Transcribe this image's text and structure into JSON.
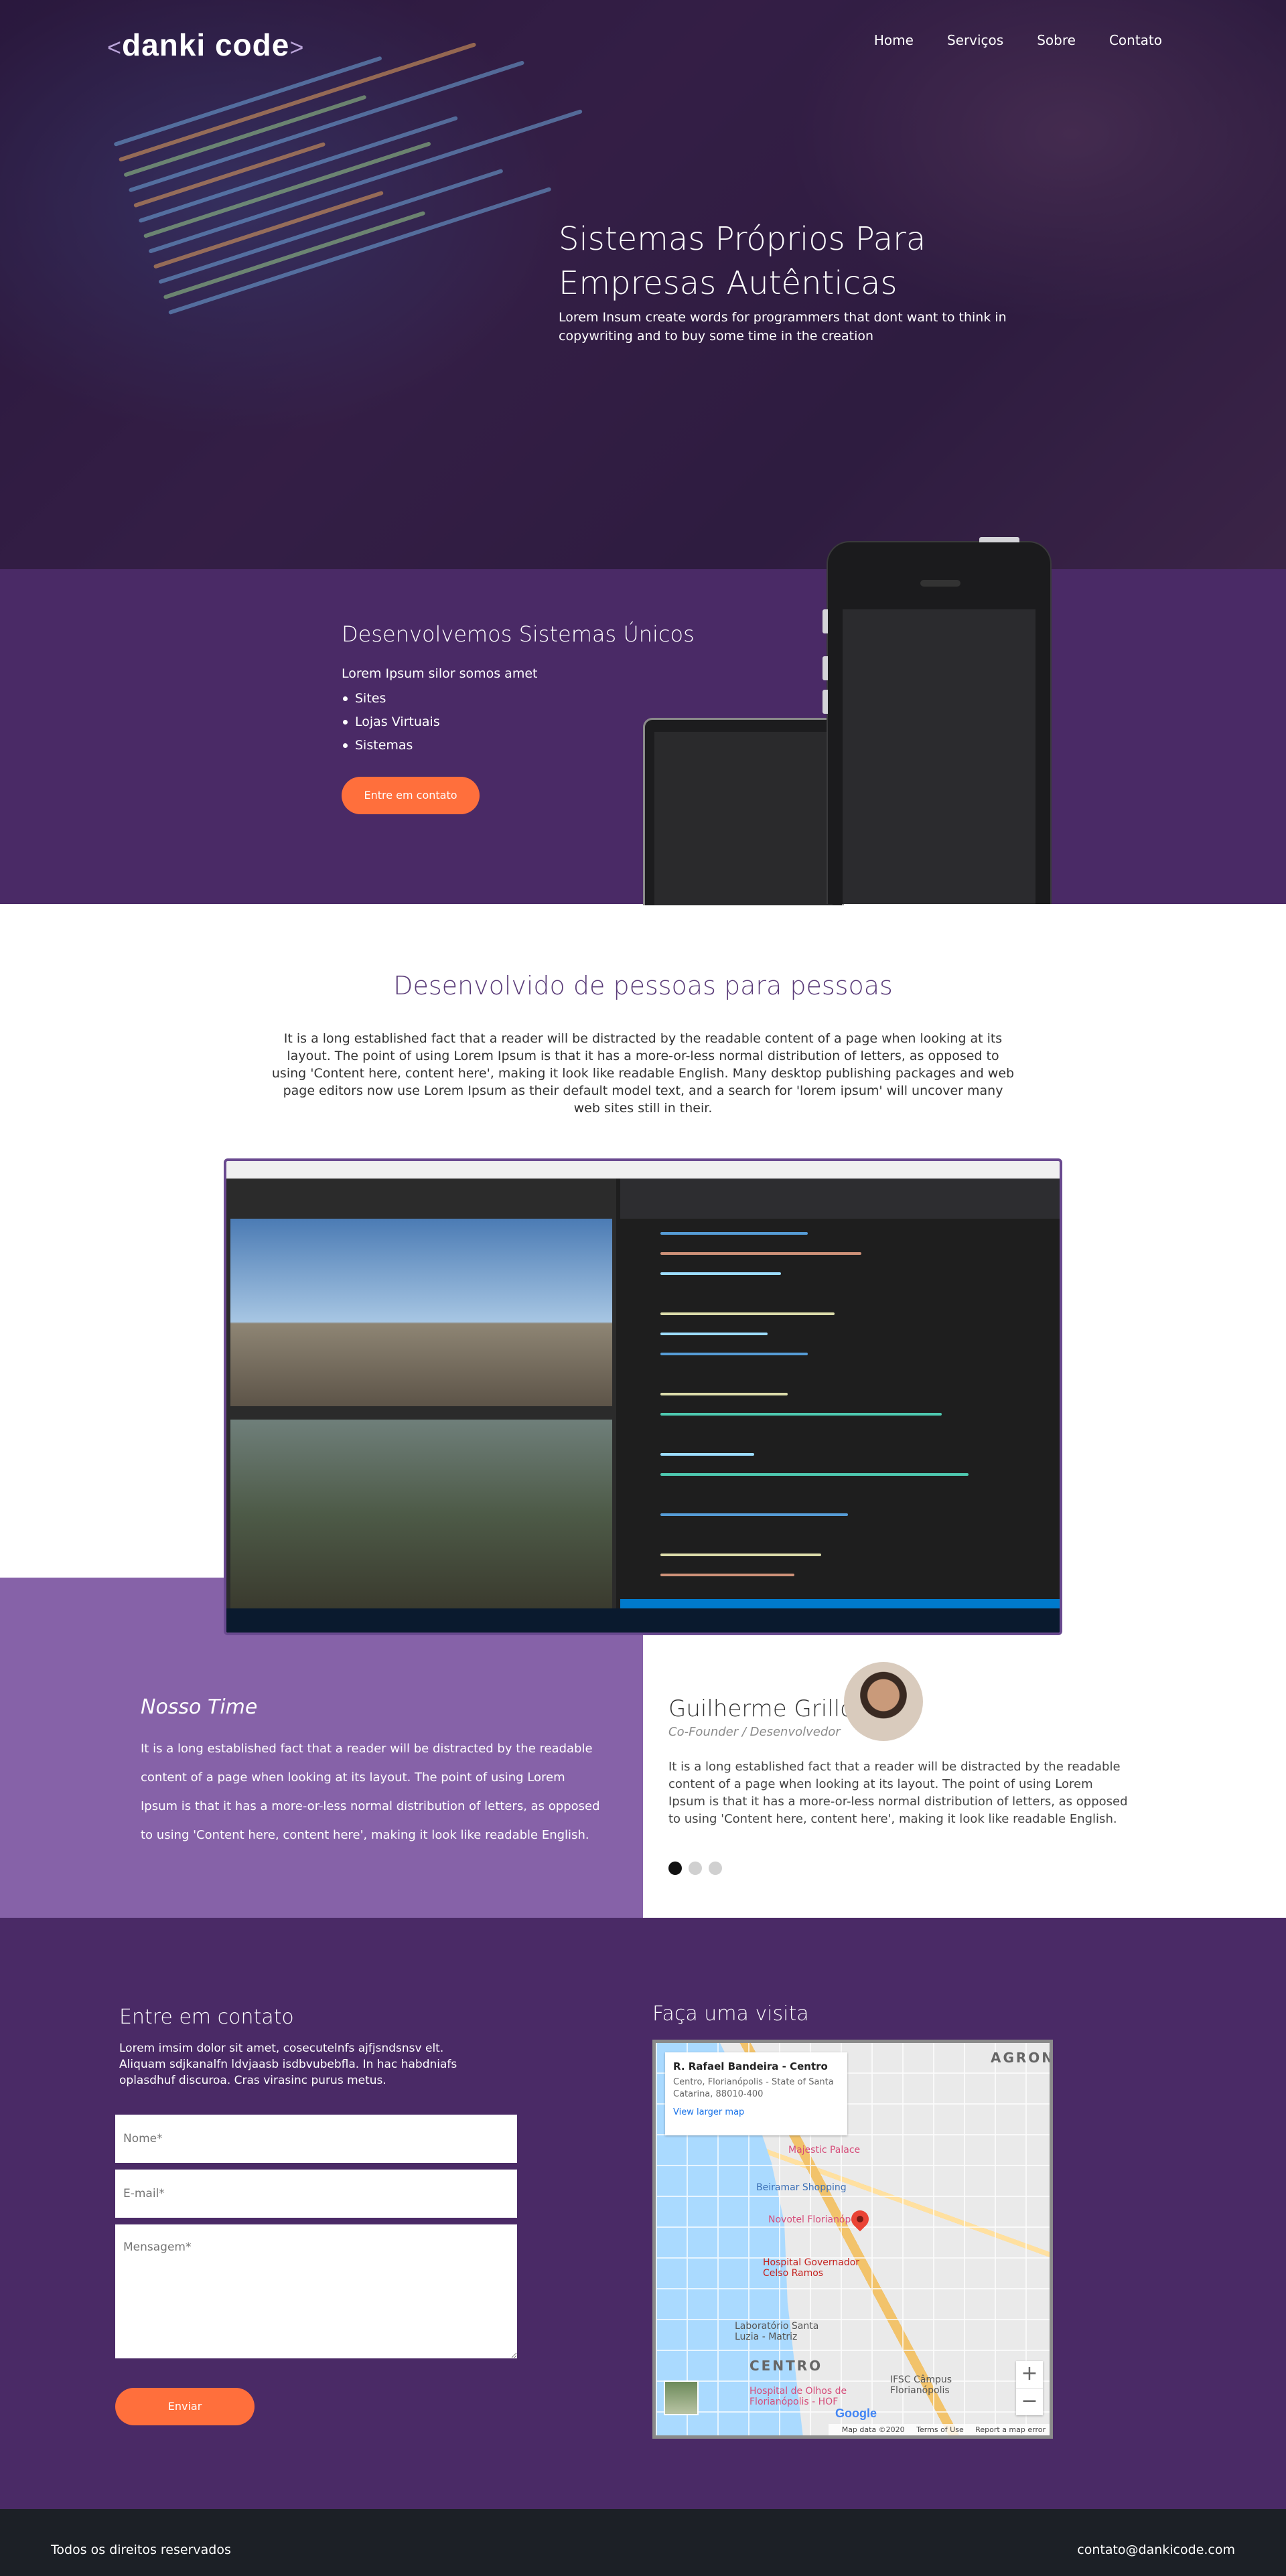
{
  "header": {
    "logo": "danki code",
    "nav": [
      "Home",
      "Serviços",
      "Sobre",
      "Contato"
    ]
  },
  "hero": {
    "title": "Sistemas Próprios Para Empresas Autênticas",
    "subtitle": "Lorem Insum create words for programmers that dont want to think in copywriting and to buy some time in the creation"
  },
  "services": {
    "title": "Desenvolvemos Sistemas Únicos",
    "lead": "Lorem Ipsum silor somos amet",
    "items": [
      "Sites",
      "Lojas Virtuais",
      "Sistemas"
    ],
    "button": "Entre em contato"
  },
  "about": {
    "title": "Desenvolvido de pessoas para pessoas",
    "text": "It is a long established fact that a reader will be distracted by the readable content of a page when looking at its layout. The point of using Lorem Ipsum is that it has a more-or-less normal distribution of letters, as opposed to using 'Content here, content here', making it look like readable English. Many desktop publishing packages and web page editors now use Lorem Ipsum as their default model text, and a search for 'lorem ipsum' will uncover many web sites still in their."
  },
  "team": {
    "title": "Nosso Time",
    "text": "It is a long established fact that a reader will be distracted by the readable content of a page when looking at its layout. The point of using Lorem Ipsum is that it has a more-or-less normal distribution of letters, as opposed to using 'Content here, content here', making it look like readable English.",
    "member": {
      "name": "Guilherme Grillo",
      "role": "Co-Founder / Desenvolvedor",
      "text": "It is a long established fact that a reader will be distracted by the readable content of a page when looking at its layout. The point of using Lorem Ipsum is that it has a more-or-less normal distribution of letters, as opposed to using 'Content here, content here', making it look like readable English."
    },
    "active_dot": 1
  },
  "contact": {
    "title": "Entre em contato",
    "text": "Lorem imsim dolor sit amet, cosecutelnfs ajfjsndsnsv elt. Aliquam sdjkanalfn ldvjaasb isdbvubebfla. In hac habdniafs oplasdhuf discuroa. Cras virasinc purus metus.",
    "name_placeholder": "Nome*",
    "email_placeholder": "E-mail*",
    "message_placeholder": "Mensagem*",
    "submit": "Enviar"
  },
  "visit": {
    "title": "Faça uma visita",
    "map": {
      "place": "R. Rafael Bandeira - Centro",
      "address": "Centro, Florianópolis - State of Santa Catarina, 88010-400",
      "larger_map": "View larger map",
      "pois": [
        "Majestic Palace",
        "Beiramar Shopping",
        "Novotel Florianópolis",
        "Hospital Governador Celso Ramos",
        "Laboratório Santa Luzia - Matriz",
        "Hospital de Olhos de Florianópolis - HOF",
        "IFSC Câmpus Florianópolis"
      ],
      "areas": [
        "AGRONÔ",
        "CENTRO"
      ],
      "zoom_in": "+",
      "zoom_out": "−",
      "attribution": [
        "Map data ©2020",
        "Terms of Use",
        "Report a map error"
      ],
      "brand": "Google"
    }
  },
  "footer": {
    "left": "Todos os direitos reservados",
    "right": "contato@dankicode.com"
  },
  "colors": {
    "purple_dark": "#4a2a66",
    "purple_light": "#8662a8",
    "orange": "#ff6f3c",
    "footer": "#1c2026"
  }
}
